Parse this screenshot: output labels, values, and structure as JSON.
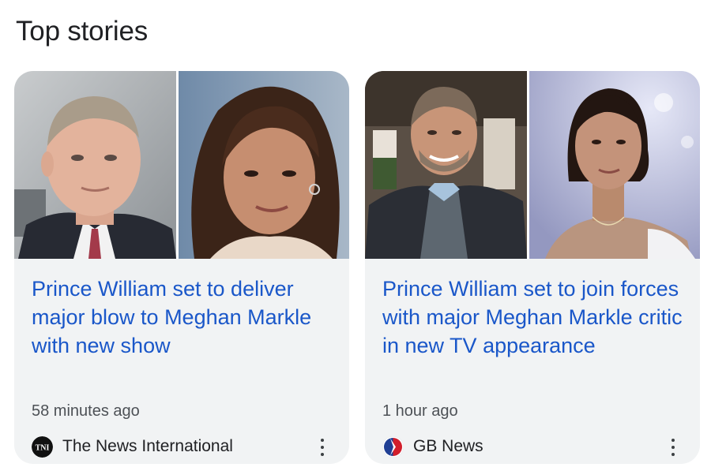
{
  "section": {
    "title": "Top stories"
  },
  "stories": [
    {
      "headline": "Prince William set to deliver major blow to Meghan Markle with new show",
      "time": "58 minutes ago",
      "source": "The News International",
      "logo_text": "TNI"
    },
    {
      "headline": "Prince William set to join forces with major Meghan Markle critic in new TV appearance",
      "time": "1 hour ago",
      "source": "GB News"
    }
  ],
  "colors": {
    "headline": "#1a57c9",
    "card_bg": "#f1f3f4",
    "meta_text": "#4d5156"
  },
  "icons": {
    "more": "more-vert-icon",
    "tni_logo": "the-news-international-logo",
    "gbnews_logo": "gb-news-logo"
  }
}
